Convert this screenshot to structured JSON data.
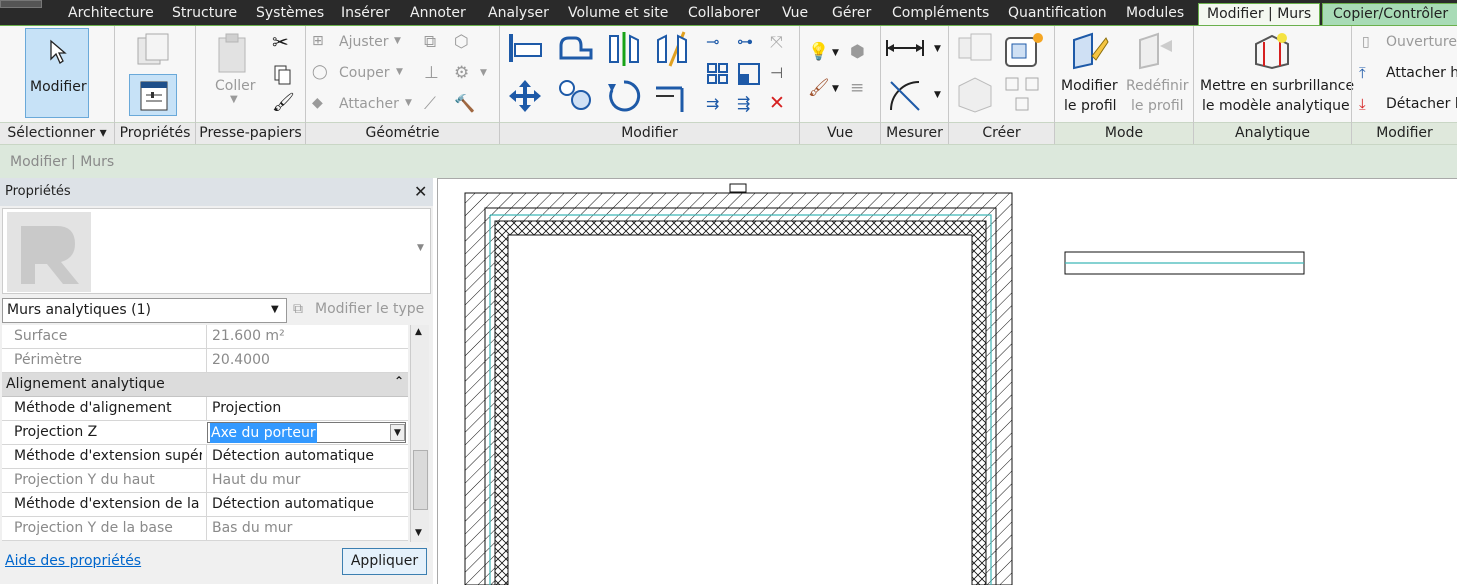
{
  "tabs": [
    "Architecture",
    "Structure",
    "Systèmes",
    "Insérer",
    "Annoter",
    "Analyser",
    "Volume et site",
    "Collaborer",
    "Vue",
    "Gérer",
    "Compléments",
    "Quantification",
    "Modules",
    "Modifier | Murs",
    "Copier/Contrôler"
  ],
  "ribbon": {
    "modify_label": "Modifier",
    "paste_label": "Coller",
    "ajuster_label": "Ajuster",
    "couper_label": "Couper",
    "attacher_label": "Attacher",
    "modifier_profil_l1": "Modifier",
    "modifier_profil_l2": "le profil",
    "redefinir_l1": "Redéfinir",
    "redefinir_l2": "le profil",
    "surbrillance_l1": "Mettre en surbrillance",
    "surbrillance_l2": "le modèle analytique",
    "ouverture_label": "Ouverture c",
    "attacher_haut_label": "Attacher ha",
    "detacher_label": "Détacher h",
    "panels": [
      "Sélectionner ▾",
      "Propriétés",
      "Presse-papiers",
      "Géométrie",
      "Modifier",
      "Vue",
      "Mesurer",
      "Créer",
      "Mode",
      "Analytique",
      "Modifier"
    ]
  },
  "option_bar": {
    "context": "Modifier | Murs"
  },
  "properties": {
    "title": "Propriétés",
    "type_selector": "Murs analytiques (1)",
    "edit_type": "Modifier le type",
    "rows": [
      {
        "k": "Surface",
        "v": "21.600 m²"
      },
      {
        "k": "Périmètre",
        "v": "20.4000"
      }
    ],
    "group": "Alignement analytique",
    "align_rows": [
      {
        "k": "Méthode d'alignement",
        "v": "Projection"
      },
      {
        "k": "Projection Z",
        "v": "Axe du porteur"
      },
      {
        "k": "Méthode d'extension supér…",
        "v": "Détection automatique"
      },
      {
        "k": "Projection Y du haut",
        "v": "Haut du mur"
      },
      {
        "k": "Méthode d'extension de la …",
        "v": "Détection automatique"
      },
      {
        "k": "Projection Y de la base",
        "v": "Bas du mur"
      }
    ],
    "help_link": "Aide des propriétés",
    "apply_button": "Appliquer"
  },
  "colors": {
    "accent_green": "#6ab04c",
    "analytic_line": "#3fb6b6",
    "selection_blue": "#3399ff",
    "link": "#0066cc"
  }
}
